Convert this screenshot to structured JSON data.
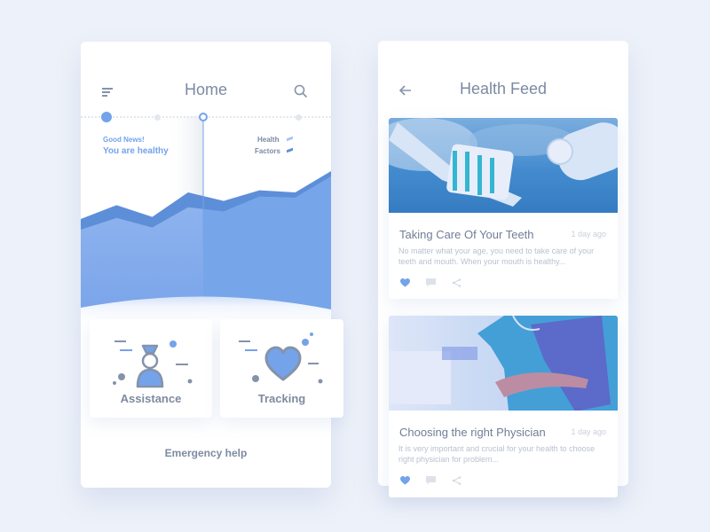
{
  "home": {
    "title": "Home",
    "menu_icon": "menu-icon",
    "search_icon": "search-icon",
    "status_kicker": "Good News!",
    "status_text": "You are healthy",
    "legend": [
      "Health",
      "Factors"
    ],
    "tiles": [
      {
        "label": "Assistance",
        "icon": "person-icon"
      },
      {
        "label": "Tracking",
        "icon": "heart-icon"
      }
    ],
    "emergency_label": "Emergency help",
    "colors": {
      "accent": "#74a3ea",
      "dark_accent": "#5d8ed8",
      "text": "#7b8aa3"
    }
  },
  "chart_data": {
    "type": "area",
    "title": "",
    "xlabel": "",
    "ylabel": "",
    "series": [
      {
        "name": "Health",
        "values": [
          0.55,
          0.68,
          0.57,
          0.8,
          0.72,
          0.82,
          0.8,
          1.0
        ]
      },
      {
        "name": "Factors",
        "values": [
          0.45,
          0.56,
          0.47,
          0.66,
          0.62,
          0.76,
          0.75,
          0.95
        ]
      }
    ],
    "timeline_points": 4,
    "selected_point": 2
  },
  "feed": {
    "title": "Health Feed",
    "back_icon": "back-arrow-icon",
    "articles": [
      {
        "title": "Taking Care Of Your Teeth",
        "time": "1 day ago",
        "excerpt": "No matter what your age, you need to take care of your teeth and mouth. When your mouth is healthy...",
        "image": "toothbrush-photo"
      },
      {
        "title": "Choosing the right Physician",
        "time": "1 day ago",
        "excerpt": "It is very important and crucial for your health to choose right physician for problem...",
        "image": "physician-photo"
      }
    ]
  }
}
